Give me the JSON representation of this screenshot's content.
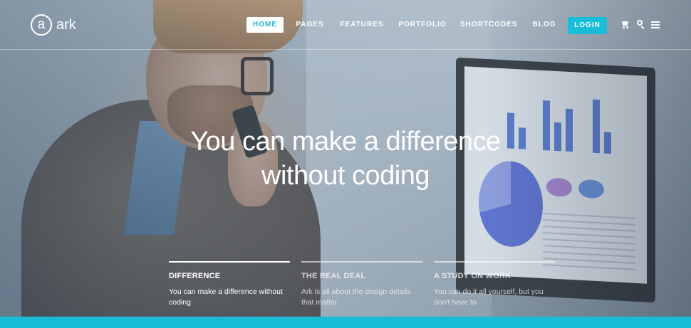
{
  "brand": {
    "logo_letter": "a",
    "name": "ark"
  },
  "nav": {
    "items": [
      {
        "label": "HOME",
        "active": true
      },
      {
        "label": "PAGES"
      },
      {
        "label": "FEATURES"
      },
      {
        "label": "PORTFOLIO"
      },
      {
        "label": "SHORTCODES"
      },
      {
        "label": "BLOG"
      }
    ],
    "login_label": "LOGIN",
    "icons": [
      "cart-icon",
      "search-icon",
      "menu-icon"
    ]
  },
  "hero": {
    "line1": "You can make a difference",
    "line2": "without coding"
  },
  "features": [
    {
      "title": "DIFFERENCE",
      "desc": "You can make a difference without coding",
      "active": true
    },
    {
      "title": "THE REAL DEAL",
      "desc": "Ark is all about the design details that matter"
    },
    {
      "title": "A STUDY ON WORK",
      "desc": "You can do it all yourself, but you don't have to"
    }
  ],
  "colors": {
    "accent": "#19bcd6",
    "nav_active_text": "#1fb6d6"
  }
}
